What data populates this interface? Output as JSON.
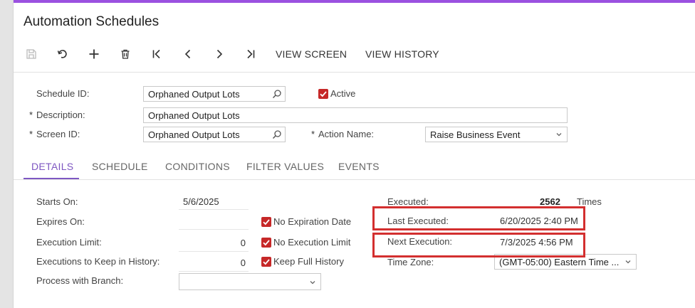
{
  "page": {
    "title": "Automation Schedules"
  },
  "toolbar": {
    "view_screen": "VIEW SCREEN",
    "view_history": "VIEW HISTORY"
  },
  "form": {
    "schedule_id": {
      "label": "Schedule ID:",
      "value": "Orphaned Output Lots"
    },
    "active": {
      "label": "Active",
      "checked": true
    },
    "description": {
      "label": "Description:",
      "value": "Orphaned Output Lots"
    },
    "screen_id": {
      "label": "Screen ID:",
      "value": "Orphaned Output Lots"
    },
    "action_name": {
      "label": "Action Name:",
      "value": "Raise Business Event"
    }
  },
  "tabs": [
    {
      "label": "DETAILS",
      "active": true
    },
    {
      "label": "SCHEDULE",
      "active": false
    },
    {
      "label": "CONDITIONS",
      "active": false
    },
    {
      "label": "FILTER VALUES",
      "active": false
    },
    {
      "label": "EVENTS",
      "active": false
    }
  ],
  "details": {
    "starts_on": {
      "label": "Starts On:",
      "value": "5/6/2025"
    },
    "expires_on": {
      "label": "Expires On:",
      "value": ""
    },
    "no_expiration_date": {
      "label": "No Expiration Date",
      "checked": true
    },
    "execution_limit": {
      "label": "Execution Limit:",
      "value": "0"
    },
    "no_execution_limit": {
      "label": "No Execution Limit",
      "checked": true
    },
    "executions_to_keep": {
      "label": "Executions to Keep in History:",
      "value": "0"
    },
    "keep_full_history": {
      "label": "Keep Full History",
      "checked": true
    },
    "process_with_branch": {
      "label": "Process with Branch:",
      "value": ""
    },
    "executed": {
      "label": "Executed:",
      "value": "2562",
      "unit": "Times"
    },
    "last_executed": {
      "label": "Last Executed:",
      "value": "6/20/2025 2:40 PM"
    },
    "next_execution": {
      "label": "Next Execution:",
      "value": "7/3/2025 4:56 PM"
    },
    "time_zone": {
      "label": "Time Zone:",
      "value": "(GMT-05:00) Eastern Time ..."
    }
  },
  "colors": {
    "accent": "#7e57c2",
    "topbar": "#9b51e0",
    "checkbox": "#c62828",
    "highlight_box": "#d32f2f"
  }
}
